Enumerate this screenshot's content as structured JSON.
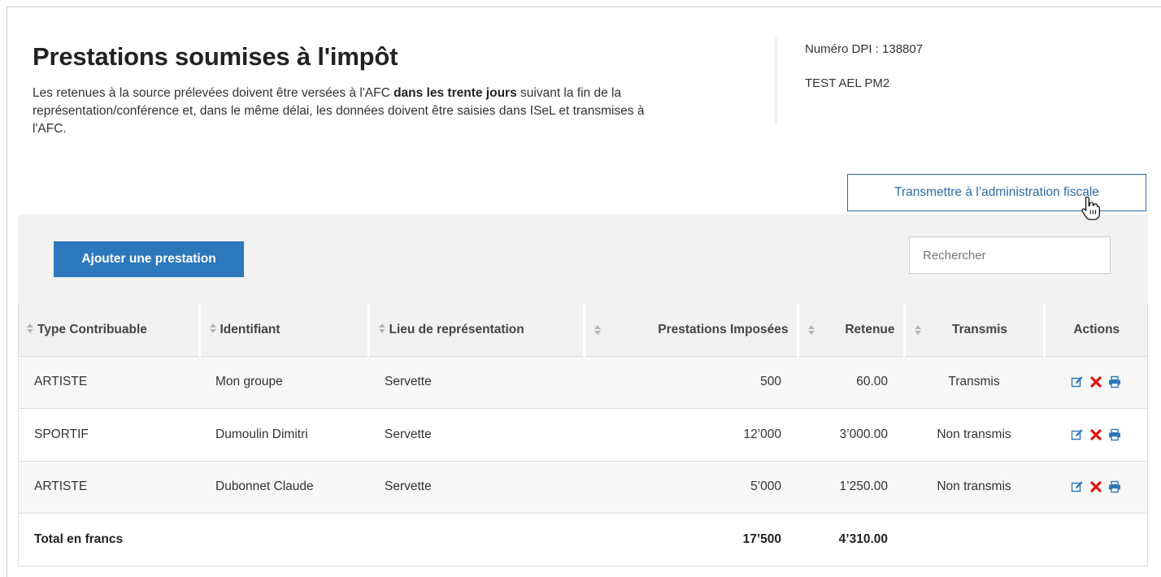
{
  "page": {
    "title": "Prestations soumises à l'impôt",
    "intro_part1": "Les retenues à la source prélevées doivent être versées à l'AFC ",
    "intro_bold": "dans les trente jours",
    "intro_part2": " suivant la fin de la représentation/conférence et, dans le même délai, les données doivent être saisies dans ISeL et transmises à l'AFC."
  },
  "account": {
    "dpi": "Numéro DPI : 138807",
    "company": "TEST AEL PM2"
  },
  "toolbar": {
    "transmit_label": "Transmettre à l’administration fiscale",
    "add_label": "Ajouter une prestation",
    "search_placeholder": "Rechercher"
  },
  "table": {
    "headers": {
      "type": "Type Contribuable",
      "identifiant": "Identifiant",
      "lieu": "Lieu de représentation",
      "prestations": "Prestations Imposées",
      "retenue": "Retenue",
      "transmis": "Transmis",
      "actions": "Actions"
    },
    "rows": [
      {
        "type": "ARTISTE",
        "identifiant": "Mon groupe",
        "lieu": "Servette",
        "prestations": "500",
        "retenue": "60.00",
        "transmis": "Transmis"
      },
      {
        "type": "SPORTIF",
        "identifiant": "Dumoulin Dimitri",
        "lieu": "Servette",
        "prestations": "12’000",
        "retenue": "3’000.00",
        "transmis": "Non transmis"
      },
      {
        "type": "ARTISTE",
        "identifiant": "Dubonnet Claude",
        "lieu": "Servette",
        "prestations": "5’000",
        "retenue": "1’250.00",
        "transmis": "Non transmis"
      }
    ],
    "total": {
      "label": "Total en francs",
      "prestations": "17’500",
      "retenue": "4’310.00"
    }
  },
  "icons": {
    "edit": "edit-icon",
    "delete": "delete-icon",
    "print": "print-icon",
    "sort": "sort-icon",
    "cursor": "hand-pointer-icon"
  },
  "colors": {
    "primary": "#2d78bd",
    "link": "#2a6ca8",
    "delete": "#e0140f",
    "header_bg": "#f2f2f2"
  }
}
